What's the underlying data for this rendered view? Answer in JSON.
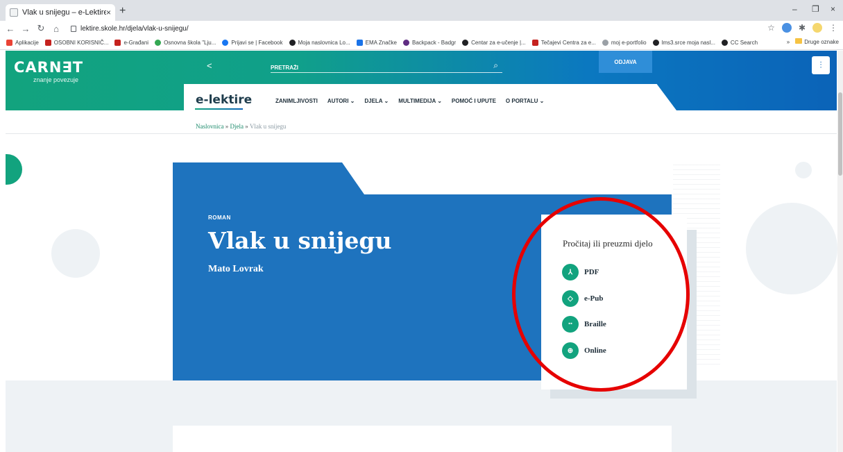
{
  "browser": {
    "tab_title": "Vlak u snijegu – e-Lektire",
    "tab_close": "×",
    "new_tab": "+",
    "url": "lektire.skole.hr/djela/vlak-u-snijegu/",
    "window_controls": [
      "–",
      "❐",
      "×"
    ],
    "bookmarks": [
      {
        "label": "Aplikacije",
        "color": "#ea4335"
      },
      {
        "label": "OSOBNI KORISNIČ...",
        "color": "#c5221f"
      },
      {
        "label": "e-Građani",
        "color": "#c5221f"
      },
      {
        "label": "Osnovna škola \"Lju...",
        "color": "#34a853"
      },
      {
        "label": "Prijavi se | Facebook",
        "color": "#1877f2"
      },
      {
        "label": "Moja naslovnica Lo...",
        "color": "#202124"
      },
      {
        "label": "EMA Značke",
        "color": "#1a73e8"
      },
      {
        "label": "Backpack - Badgr",
        "color": "#5f2d82"
      },
      {
        "label": "Centar za e-učenje |...",
        "color": "#202124"
      },
      {
        "label": "Tečajevi Centra za e...",
        "color": "#c5221f"
      },
      {
        "label": "moj e-portfolio",
        "color": "#9aa0a6"
      },
      {
        "label": "lms3.srce moja nasl...",
        "color": "#202124"
      },
      {
        "label": "CC Search",
        "color": "#202124"
      }
    ],
    "bookmarks_more": "»",
    "other_bookmarks": "Druge oznake"
  },
  "header": {
    "logo": "CARN∃T",
    "logo_sub": "znanje povezuje",
    "search_placeholder": "PRETRAŽI",
    "logout": "ODJAVA",
    "site_logo": "e-lektire",
    "nav": [
      "ZANIMLJIVOSTI",
      "AUTORI ⌄",
      "DJELA ⌄",
      "MULTIMEDIJA ⌄",
      "POMOĆ I UPUTE",
      "O PORTALU ⌄"
    ]
  },
  "breadcrumb": {
    "home": "Naslovnica",
    "section": "Djela",
    "current": "Vlak u snijegu",
    "sep": "»"
  },
  "book": {
    "genre": "ROMAN",
    "title": "Vlak u snijegu",
    "author": "Mato Lovrak"
  },
  "read_card": {
    "title": "Pročitaj ili preuzmi djelo",
    "options": [
      {
        "label": "PDF",
        "icon": "pdf-icon"
      },
      {
        "label": "e-Pub",
        "icon": "epub-icon"
      },
      {
        "label": "Braille",
        "icon": "braille-icon"
      },
      {
        "label": "Online",
        "icon": "globe-icon"
      }
    ]
  },
  "colors": {
    "accent_green": "#12a37e",
    "hero_blue": "#1e73be",
    "highlight_red": "#e60000"
  }
}
